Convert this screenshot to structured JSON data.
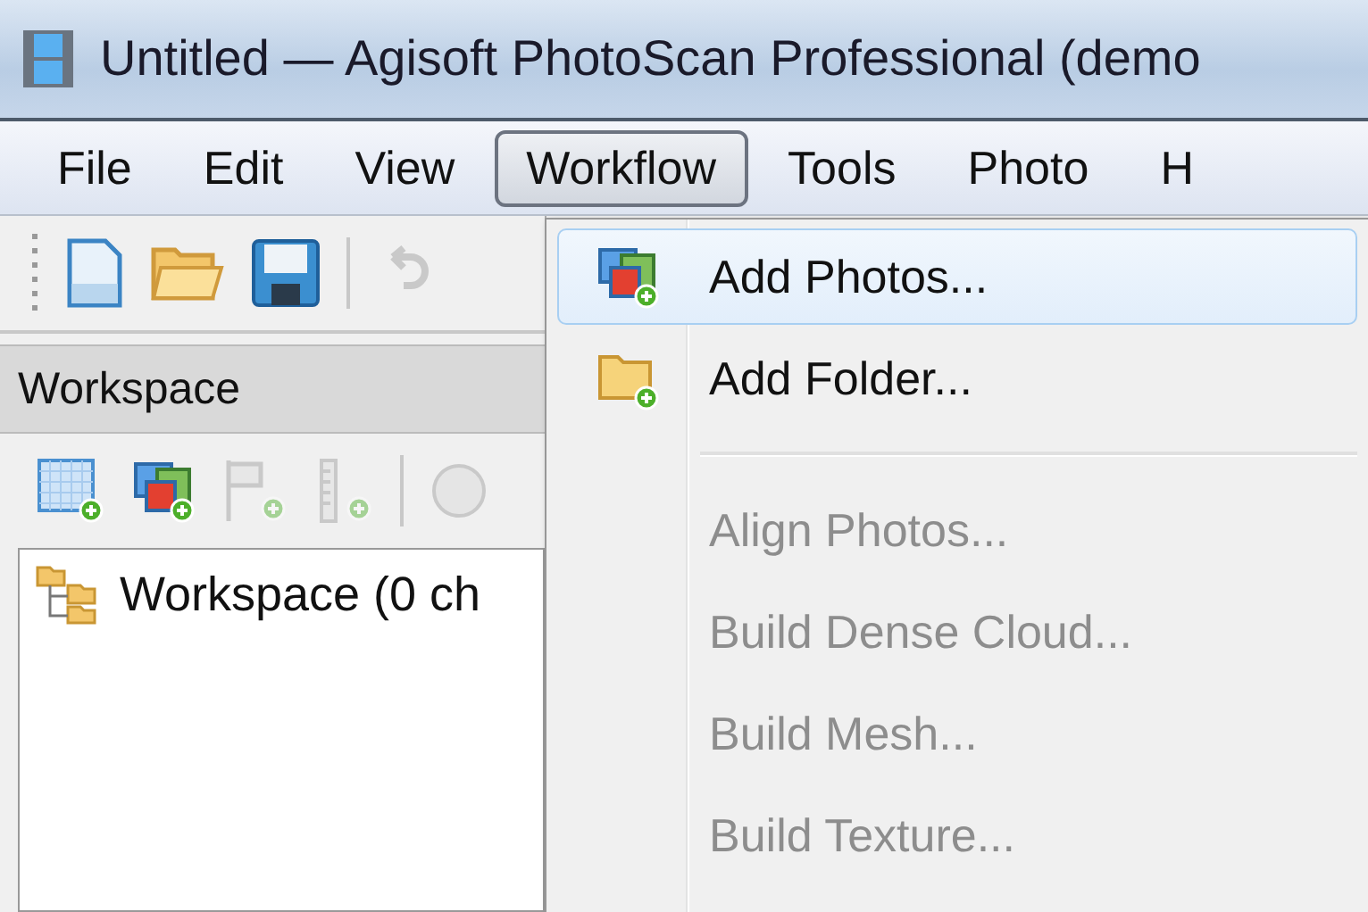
{
  "window": {
    "title": "Untitled — Agisoft PhotoScan Professional (demo"
  },
  "menu_bar": [
    {
      "label": "File",
      "selected": false
    },
    {
      "label": "Edit",
      "selected": false
    },
    {
      "label": "View",
      "selected": false
    },
    {
      "label": "Workflow",
      "selected": true
    },
    {
      "label": "Tools",
      "selected": false
    },
    {
      "label": "Photo",
      "selected": false
    },
    {
      "label": "H",
      "selected": false
    }
  ],
  "toolbar": [
    {
      "kind": "new",
      "disabled": false
    },
    {
      "kind": "open",
      "disabled": false
    },
    {
      "kind": "save",
      "disabled": false
    },
    {
      "kind": "separator",
      "disabled": false
    },
    {
      "kind": "undo",
      "disabled": true
    }
  ],
  "workspace": {
    "title": "Workspace",
    "toolbar": [
      {
        "kind": "chunk",
        "disabled": false
      },
      {
        "kind": "photos",
        "disabled": false
      },
      {
        "kind": "marker",
        "disabled": true
      },
      {
        "kind": "scalebar",
        "disabled": true
      },
      {
        "kind": "separator",
        "disabled": false
      },
      {
        "kind": "circle",
        "disabled": true
      }
    ],
    "tree": [
      {
        "label": "Workspace (0 ch"
      }
    ]
  },
  "workflow_menu": [
    {
      "kind": "item",
      "label": "Add Photos...",
      "disabled": false,
      "selected": true
    },
    {
      "kind": "item",
      "label": "Add Folder...",
      "disabled": false,
      "selected": false
    },
    {
      "kind": "separator"
    },
    {
      "kind": "item",
      "label": "Align Photos...",
      "disabled": true,
      "selected": false
    },
    {
      "kind": "item",
      "label": "Build Dense Cloud...",
      "disabled": true,
      "selected": false
    },
    {
      "kind": "item",
      "label": "Build Mesh...",
      "disabled": true,
      "selected": false
    },
    {
      "kind": "item",
      "label": "Build Texture...",
      "disabled": true,
      "selected": false
    }
  ]
}
